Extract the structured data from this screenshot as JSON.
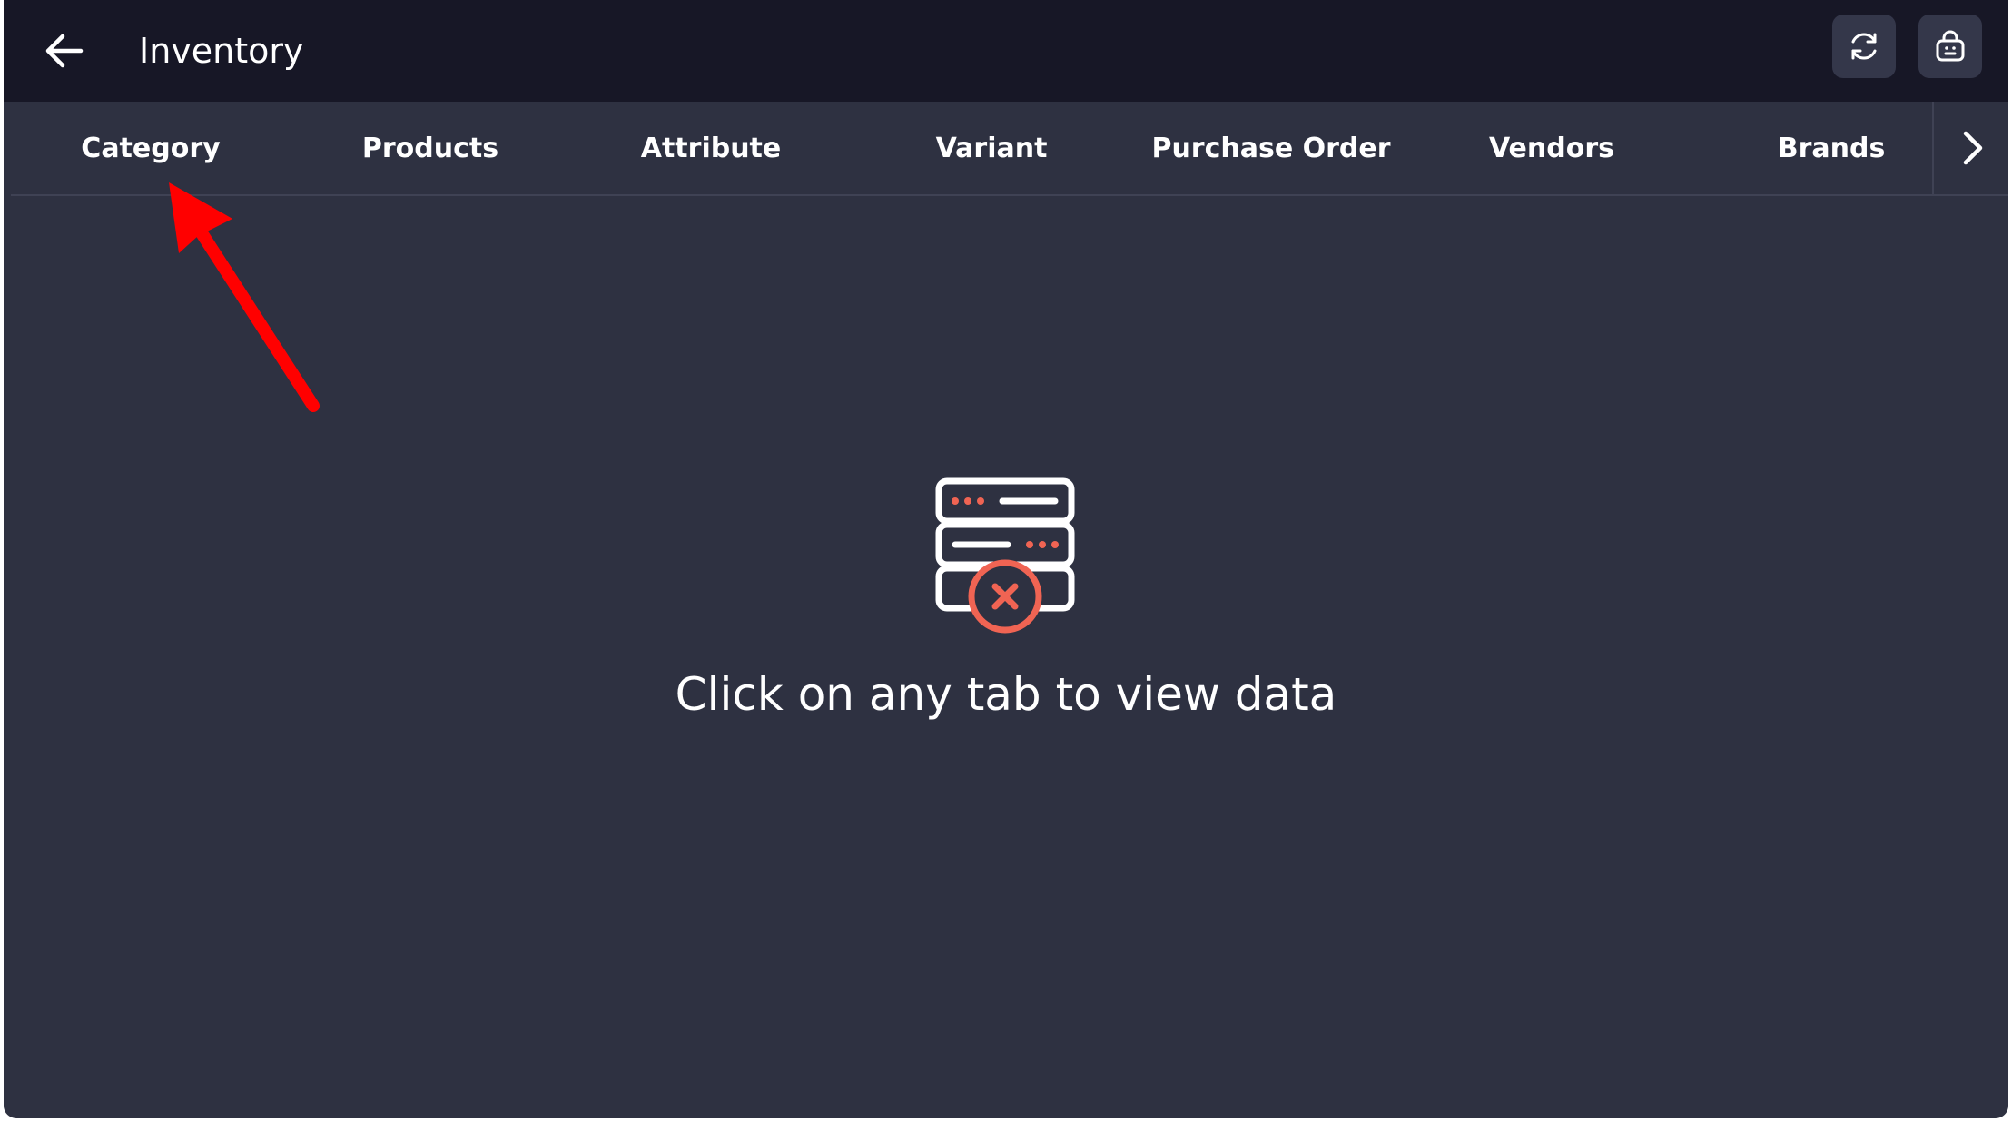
{
  "header": {
    "title": "Inventory",
    "back_icon": "arrow-left-icon",
    "refresh_icon": "refresh-icon",
    "store_icon": "store-bag-icon"
  },
  "tabs": [
    {
      "label": "Category"
    },
    {
      "label": "Products"
    },
    {
      "label": "Attribute"
    },
    {
      "label": "Variant"
    },
    {
      "label": "Purchase Order"
    },
    {
      "label": "Vendors"
    },
    {
      "label": "Brands"
    }
  ],
  "tab_next_icon": "chevron-right-icon",
  "empty_state": {
    "icon": "server-error-icon",
    "message": "Click on any tab to view data"
  },
  "colors": {
    "background": "#2e3141",
    "topbar": "#171726",
    "accent": "#f06453",
    "annotation_arrow": "#ff0000"
  }
}
